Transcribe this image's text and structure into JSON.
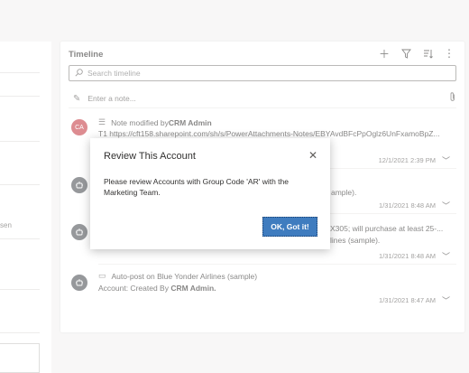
{
  "left_panel": {
    "fragment_text": "sen"
  },
  "timeline": {
    "title": "Timeline",
    "actions": [
      "add-icon",
      "filter-icon",
      "sort-icon",
      "more-icon"
    ],
    "search_placeholder": "Search timeline",
    "note_placeholder": "Enter a note...",
    "entries": [
      {
        "avatar_text": "CA",
        "avatar_color": "#c43a43",
        "title_prefix": "Note modified by ",
        "title_bold": "CRM Admin",
        "body": "T1 https://cft158.sharepoint.com/sh/s/PowerAttachments-Notes/EBYAvdBFcPpOglz6UnFxamoBpZ...",
        "date": "12/1/2021 2:39 PM"
      },
      {
        "avatar_text": "",
        "avatar_color": "#4a4f54",
        "title_prefix": "",
        "title_bold": "",
        "body": "ample).",
        "date": "1/31/2021 8:48 AM"
      },
      {
        "avatar_text": "",
        "avatar_color": "#4a4f54",
        "title_prefix": "",
        "title_bold": "",
        "body": "X305; will purchase at least 25-...",
        "body2": "lines (sample).",
        "date": "1/31/2021 8:48 AM"
      },
      {
        "avatar_text": "",
        "avatar_color": "#4a4f54",
        "title_prefix": "Auto-post on Blue Yonder Airlines (sample)",
        "title_bold": "",
        "body_prefix": "Account: Created By ",
        "body_bold": "CRM Admin.",
        "date": "1/31/2021 8:47 AM"
      }
    ]
  },
  "dialog": {
    "title": "Review This Account",
    "message": "Please review Accounts with Group Code 'AR' with the Marketing Team.",
    "ok_label": "OK, Got it!",
    "ok_color": "#3f7cbf"
  }
}
